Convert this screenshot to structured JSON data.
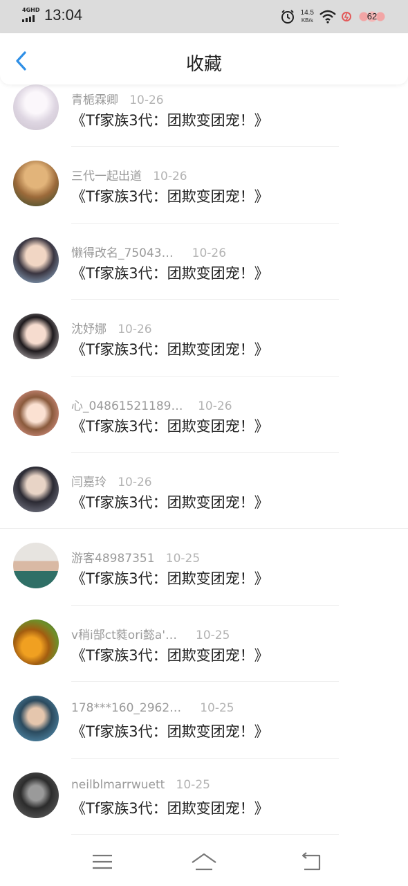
{
  "status_bar": {
    "network": "4GHD",
    "time": "13:04",
    "speed_value": "14.5",
    "speed_unit": "KB/s",
    "battery": "62",
    "icons": [
      "signal-icon",
      "alarm-icon",
      "wifi-icon",
      "hotspot-icon",
      "battery-icon"
    ]
  },
  "header": {
    "title": "收藏",
    "back_icon": "chevron-left-icon",
    "accent_color": "#2e8fe6"
  },
  "favorites": [
    {
      "user": "青栀霖卿",
      "date": "10-26",
      "title": "《Tf家族3代：团欺变团宠！》",
      "avatar": "#e9e4ea"
    },
    {
      "user": "三代一起出道",
      "date": "10-26",
      "title": "《Tf家族3代：团欺变团宠！》",
      "avatar": "#b88a55"
    },
    {
      "user": "懒得改名_75043…",
      "date": "10-26",
      "title": "《Tf家族3代：团欺变团宠！》",
      "avatar": "#8aa6c4"
    },
    {
      "user": "沈妤娜",
      "date": "10-26",
      "title": "《Tf家族3代：团欺变团宠！》",
      "avatar": "#2a2226"
    },
    {
      "user": "心_04861521189…",
      "date": "10-26",
      "title": "《Tf家族3代：团欺变团宠！》",
      "avatar": "#f0b8a4"
    },
    {
      "user": "闫嘉玲",
      "date": "10-26",
      "title": "《Tf家族3代：团欺变团宠！》",
      "avatar": "#6b6f80"
    },
    {
      "user": "游客48987351",
      "date": "10-25",
      "title": "《Tf家族3代：团欺变团宠！》",
      "avatar": "#3f8a7a"
    },
    {
      "user": "v稍i郜ct蕤ori懿a'…",
      "date": "10-25",
      "title": "《Tf家族3代：团欺变团宠！》",
      "avatar": "#c77a1c"
    },
    {
      "user": "178***160_2962…",
      "date": "10-25",
      "title": "《Tf家族3代：团欺变团宠！》",
      "avatar": "#3c7fa8"
    },
    {
      "user": "neilblmarrwuett",
      "date": "10-25",
      "title": "《Tf家族3代：团欺变团宠！》",
      "avatar": "#3a3a3a"
    }
  ],
  "navbar": {
    "icons": [
      "menu-icon",
      "home-icon",
      "back-icon"
    ]
  }
}
